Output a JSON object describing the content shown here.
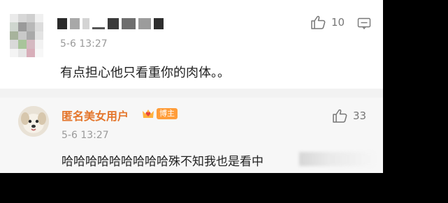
{
  "comments": [
    {
      "username": "",
      "time": "5-6 13:27",
      "text": "有点担心他只看重你的肉体。。",
      "likes": "10",
      "avatar_icon": "pixelated-avatar",
      "like_icon": "thumbs-up-icon",
      "reply_icon": "comment-icon"
    },
    {
      "username": "匿名美女用户",
      "badge_host": "博主",
      "time": "5-6 13:27",
      "text": "哈哈哈哈哈哈哈哈哈殊不知我也是看中",
      "likes": "33",
      "avatar_icon": "dog-avatar",
      "like_icon": "thumbs-up-icon",
      "badge_icon": "crown-heart-icon"
    }
  ],
  "colors": {
    "username": "#e4762c",
    "badge": "#ff9d3a",
    "muted": "#9a9a9a",
    "text": "#222222"
  }
}
